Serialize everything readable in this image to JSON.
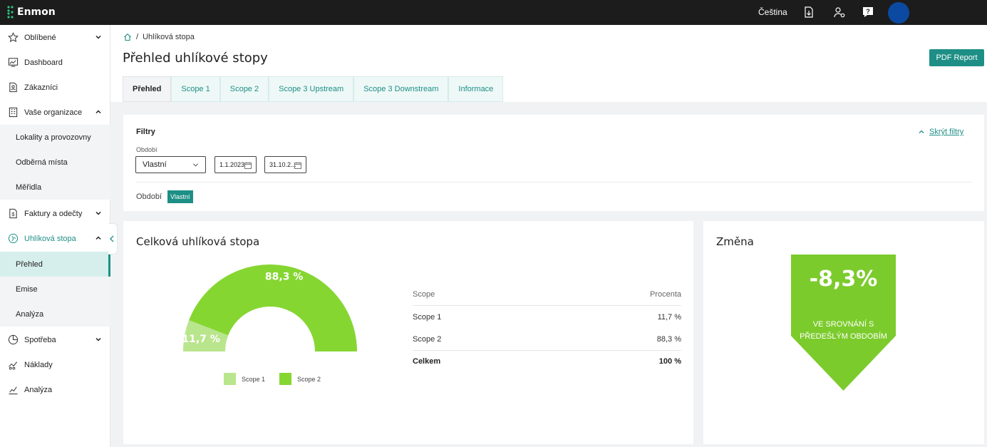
{
  "topbar": {
    "brand": "Enmon",
    "language": "Čeština"
  },
  "sidebar": {
    "items": [
      {
        "label": "Oblíbené"
      },
      {
        "label": "Dashboard"
      },
      {
        "label": "Zákazníci"
      },
      {
        "label": "Vaše organizace"
      },
      {
        "label": "Lokality a provozovny"
      },
      {
        "label": "Odběrná místa"
      },
      {
        "label": "Měřidla"
      },
      {
        "label": "Faktury a odečty"
      },
      {
        "label": "Uhlíková stopa"
      },
      {
        "label": "Přehled"
      },
      {
        "label": "Emise"
      },
      {
        "label": "Analýza"
      },
      {
        "label": "Spotřeba"
      },
      {
        "label": "Náklady"
      },
      {
        "label": "Analýza"
      }
    ]
  },
  "breadcrumb": {
    "current": "Uhlíková stopa",
    "separator": "/"
  },
  "page": {
    "title": "Přehled uhlíkové stopy",
    "pdf_button": "PDF Report"
  },
  "tabs": [
    "Přehled",
    "Scope 1",
    "Scope 2",
    "Scope 3 Upstream",
    "Scope 3 Downstream",
    "Informace"
  ],
  "filters": {
    "title": "Filtry",
    "hide_label": "Skrýt filtry",
    "period_label": "Období",
    "period_select": "Vlastní",
    "date_from": "1.1.2023",
    "date_to": "31.10.2...",
    "active_label": "Období",
    "active_chip": "Vlastní"
  },
  "total_card": {
    "title": "Celková uhlíková stopa",
    "table": {
      "headers": [
        "Scope",
        "Procenta"
      ],
      "rows": [
        {
          "scope": "Scope 1",
          "percent": "11,7 %"
        },
        {
          "scope": "Scope 2",
          "percent": "88,3 %"
        }
      ],
      "total": {
        "label": "Celkem",
        "percent": "100 %"
      }
    }
  },
  "chart_data": {
    "type": "pie",
    "variant": "half-donut",
    "categories": [
      "Scope 1",
      "Scope 2"
    ],
    "values": [
      11.7,
      88.3
    ],
    "labels": [
      "11,7 %",
      "88,3 %"
    ],
    "colors": [
      "#b9e58d",
      "#86d632"
    ],
    "legend": "bottom"
  },
  "change_card": {
    "title": "Změna",
    "value": "-8,3%",
    "text": "VE SROVNÁNÍ S PŘEDEŠLÝM OBDOBÍM",
    "color": "#7ccb2c"
  },
  "colors": {
    "accent": "#1e8f86",
    "topbar": "#1c1c1c",
    "avatar": "#0b4aa0"
  }
}
